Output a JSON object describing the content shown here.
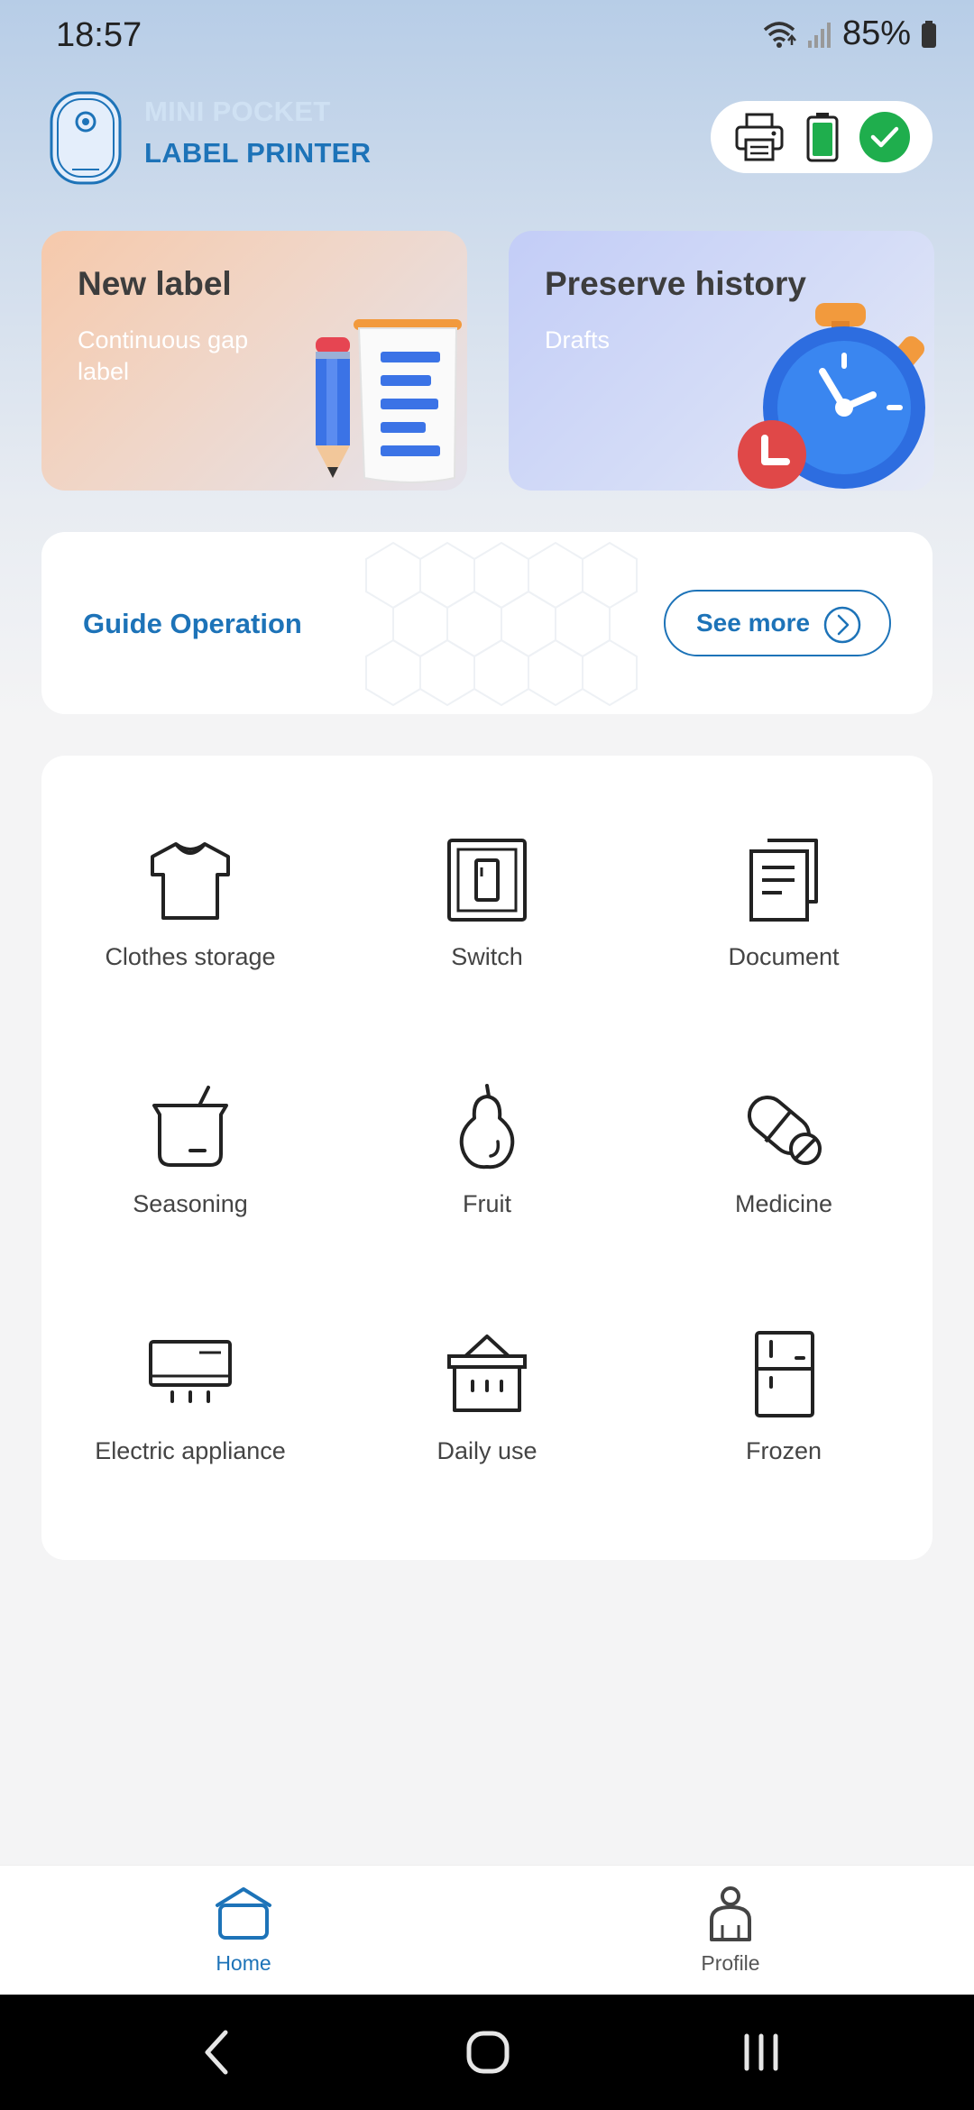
{
  "status_bar": {
    "time": "18:57",
    "battery": "85%"
  },
  "header": {
    "brand_line1": "MINI POCKET",
    "brand_line2": "LABEL PRINTER"
  },
  "cards": {
    "new_label": {
      "title": "New label",
      "subtitle": "Continuous gap label"
    },
    "preserve_history": {
      "title": "Preserve history",
      "subtitle": "Drafts"
    }
  },
  "guide": {
    "title": "Guide Operation",
    "button": "See more"
  },
  "categories": [
    {
      "label": "Clothes storage",
      "icon": "tshirt-icon"
    },
    {
      "label": "Switch",
      "icon": "switch-icon"
    },
    {
      "label": "Document",
      "icon": "document-icon"
    },
    {
      "label": "Seasoning",
      "icon": "seasoning-icon"
    },
    {
      "label": "Fruit",
      "icon": "pear-icon"
    },
    {
      "label": "Medicine",
      "icon": "pill-icon"
    },
    {
      "label": "Electric appliance",
      "icon": "air-conditioner-icon"
    },
    {
      "label": "Daily use",
      "icon": "basket-icon"
    },
    {
      "label": "Frozen",
      "icon": "fridge-icon"
    }
  ],
  "bottom_nav": {
    "home": "Home",
    "profile": "Profile"
  },
  "colors": {
    "accent": "#1d73b8",
    "connected": "#1fae4d",
    "battery": "#1fae4d"
  }
}
